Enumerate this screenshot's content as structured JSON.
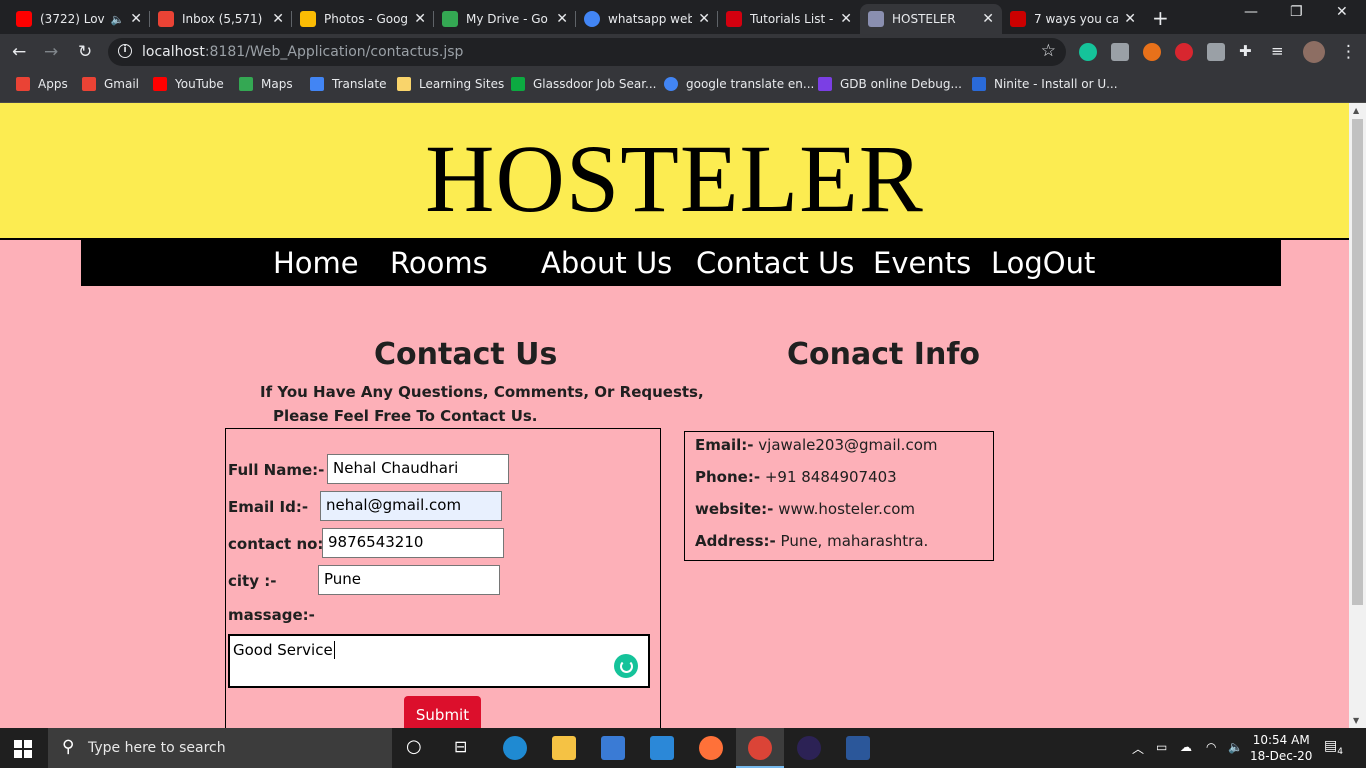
{
  "tabs": [
    {
      "title": "(3722) Lov",
      "favicon_color": "#ff0000",
      "extra": "🔈"
    },
    {
      "title": "Inbox (5,571) -",
      "favicon_color": "#ea4335"
    },
    {
      "title": "Photos - Goog",
      "favicon_color": "#fbbc04"
    },
    {
      "title": "My Drive - Go",
      "favicon_color": "#34a853"
    },
    {
      "title": "whatsapp web",
      "favicon_color": "#4285f4"
    },
    {
      "title": "Tutorials List -",
      "favicon_color": "#d4000f"
    },
    {
      "title": "HOSTELER",
      "favicon_color": "#8a8fb0"
    },
    {
      "title": "7 ways you ca",
      "favicon_color": "#cc0000"
    }
  ],
  "window": {
    "minimize": "—",
    "restore": "❐",
    "close": "✕",
    "new_tab": "+"
  },
  "omnibox": {
    "host": "localhost",
    "path": ":8181/Web_Application/contactus.jsp"
  },
  "bookmarks": [
    {
      "label": "Apps",
      "color": "#ea4335"
    },
    {
      "label": "Gmail",
      "color": "#ea4335"
    },
    {
      "label": "YouTube",
      "color": "#ff0000"
    },
    {
      "label": "Maps",
      "color": "#34a853"
    },
    {
      "label": "Translate",
      "color": "#4285f4"
    },
    {
      "label": "Learning Sites",
      "color": "#f9d46b"
    },
    {
      "label": "Glassdoor Job Sear...",
      "color": "#0caa41"
    },
    {
      "label": "google translate en...",
      "color": "#4285f4"
    },
    {
      "label": "GDB online Debug...",
      "color": "#7b3fe4"
    },
    {
      "label": "Ninite - Install or U...",
      "color": "#2a6ad8"
    }
  ],
  "site": {
    "brand": "HOSTELER",
    "nav": [
      "Home",
      "Rooms",
      "About Us",
      "Contact Us",
      "Events",
      "LogOut"
    ],
    "contact_title": "Contact Us",
    "contact_sub_1": "If You Have Any Questions, Comments, Or Requests,",
    "contact_sub_2": "Please Feel Free To Contact Us.",
    "form": {
      "name_label": "Full Name:-",
      "name_value": "Nehal Chaudhari",
      "email_label": "Email Id:-",
      "email_value": "nehal@gmail.com",
      "contact_label": "contact no:-",
      "contact_value": "9876543210",
      "city_label": "city :-",
      "city_value": "Pune",
      "message_label": "massage:-",
      "message_value": "Good Service",
      "submit_label": "Submit"
    },
    "info_title": "Conact Info",
    "info": {
      "email_label": "Email:-",
      "email_value": "vjawale203@gmail.com",
      "phone_label": "Phone:-",
      "phone_value": "+91 8484907403",
      "website_label": "website:-",
      "website_value": "www.hosteler.com",
      "address_label": "Address:-",
      "address_value": "Pune, maharashtra."
    }
  },
  "taskbar": {
    "search_placeholder": "Type here to search",
    "time": "10:54 AM",
    "date": "18-Dec-20",
    "notifications": "4"
  }
}
